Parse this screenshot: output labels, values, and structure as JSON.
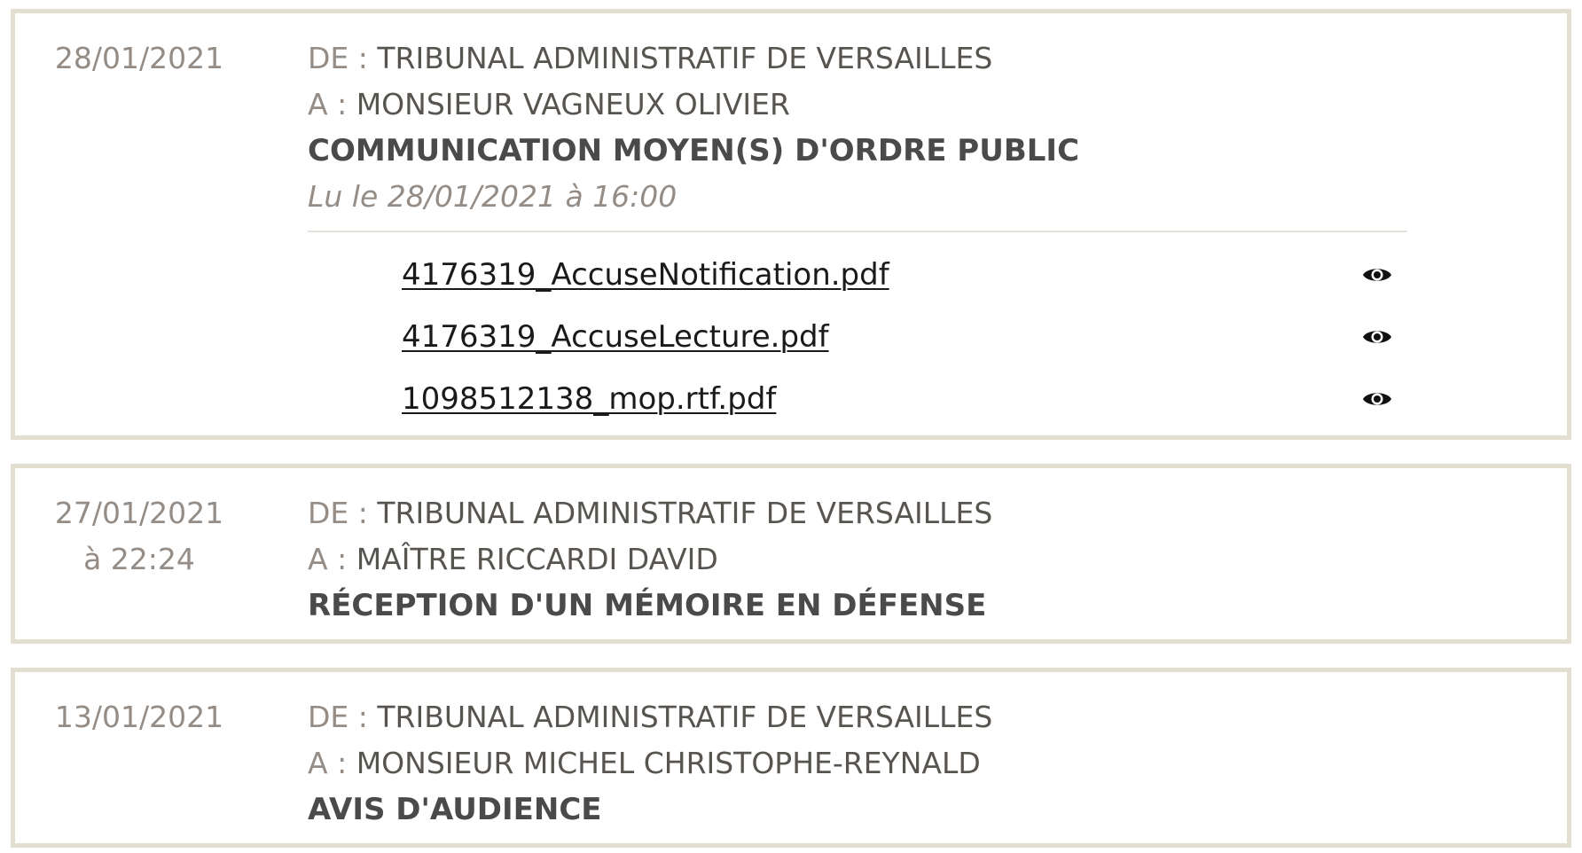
{
  "messages": [
    {
      "date": "28/01/2021",
      "time": "",
      "from_prefix": "DE :",
      "from": "TRIBUNAL ADMINISTRATIF DE VERSAILLES",
      "to_prefix": "A :",
      "to": "MONSIEUR VAGNEUX OLIVIER",
      "subject": "COMMUNICATION MOYEN(S) D'ORDRE PUBLIC",
      "read_status": "Lu le 28/01/2021 à 16:00",
      "attachments": [
        {
          "filename": "4176319_AccuseNotification.pdf",
          "icon": "eye-icon"
        },
        {
          "filename": "4176319_AccuseLecture.pdf",
          "icon": "eye-icon"
        },
        {
          "filename": "1098512138_mop.rtf.pdf",
          "icon": "eye-icon"
        }
      ]
    },
    {
      "date": "27/01/2021",
      "time": "à 22:24",
      "from_prefix": "DE :",
      "from": "TRIBUNAL ADMINISTRATIF DE VERSAILLES",
      "to_prefix": "A :",
      "to": "MAÎTRE RICCARDI DAVID",
      "subject": "RÉCEPTION D'UN MÉMOIRE EN DÉFENSE"
    },
    {
      "date": "13/01/2021",
      "time": "",
      "from_prefix": "DE :",
      "from": "TRIBUNAL ADMINISTRATIF DE VERSAILLES",
      "to_prefix": "A :",
      "to": "MONSIEUR MICHEL CHRISTOPHE-REYNALD",
      "subject": "AVIS D'AUDIENCE"
    }
  ],
  "colors": {
    "card_border": "#e2ded2",
    "muted_text": "#948c85",
    "body_text": "#585450",
    "subject_text": "#4a4a4a",
    "link_text": "#1a1a1a"
  }
}
